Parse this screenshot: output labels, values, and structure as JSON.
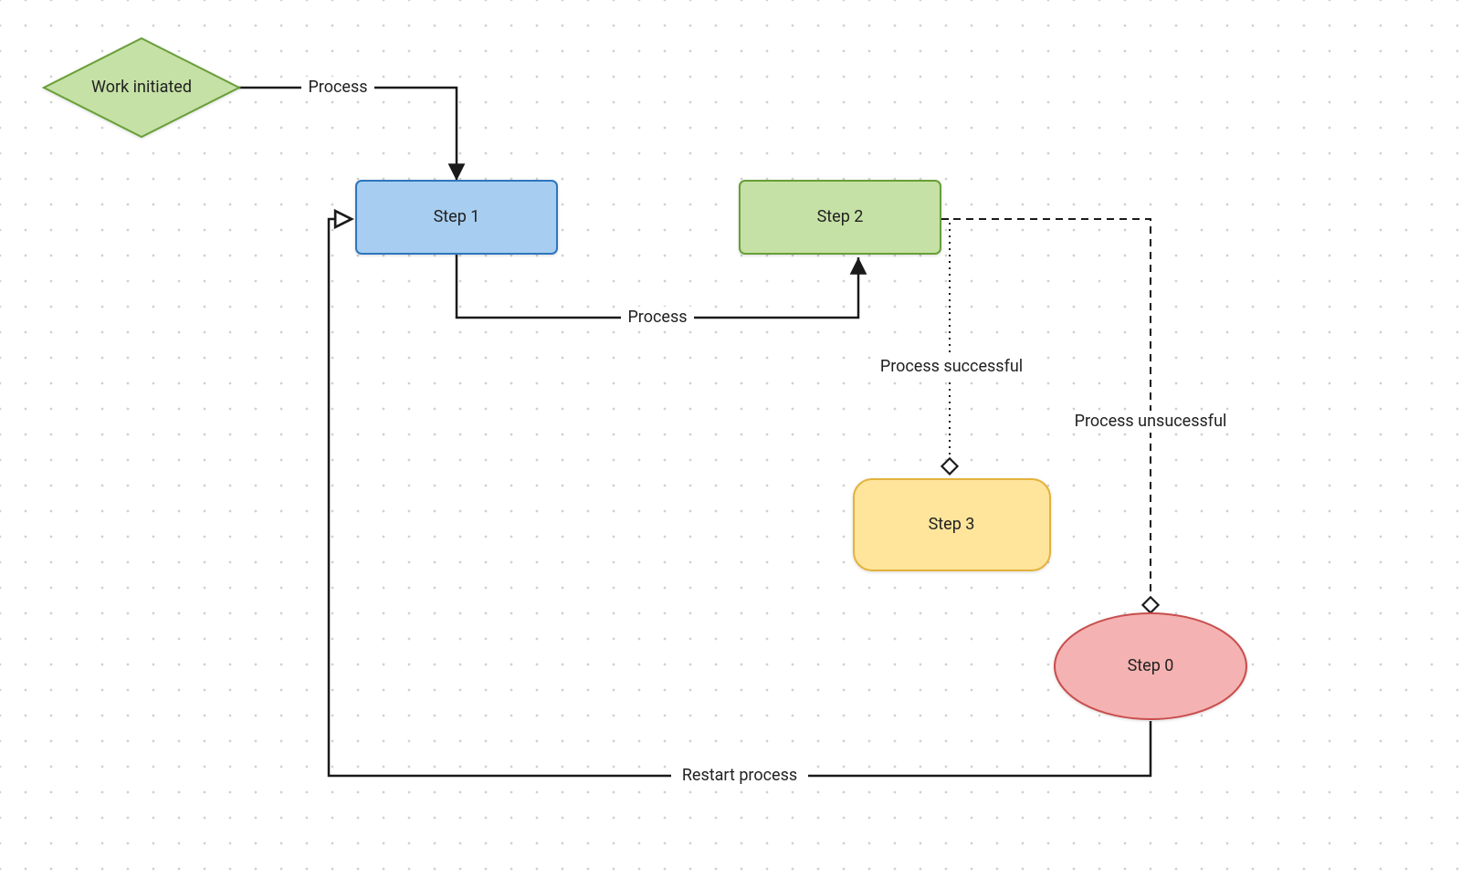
{
  "nodes": {
    "work_initiated": {
      "label": "Work initiated",
      "fill": "#c5e1a5",
      "stroke": "#689f38"
    },
    "step1": {
      "label": "Step 1",
      "fill": "#a7cdf0",
      "stroke": "#2f76bd"
    },
    "step2": {
      "label": "Step 2",
      "fill": "#c5e1a5",
      "stroke": "#689f38"
    },
    "step3": {
      "label": "Step 3",
      "fill": "#ffe59b",
      "stroke": "#e3b23c"
    },
    "step0": {
      "label": "Step 0",
      "fill": "#f5b2b2",
      "stroke": "#c94d4d"
    }
  },
  "edges": {
    "wi_to_s1": {
      "label": "Process"
    },
    "s1_to_s2": {
      "label": "Process"
    },
    "s2_to_s3": {
      "label": "Process successful"
    },
    "s2_to_s0": {
      "label": "Process unsucessful"
    },
    "s0_to_s1": {
      "label": "Restart process"
    }
  }
}
